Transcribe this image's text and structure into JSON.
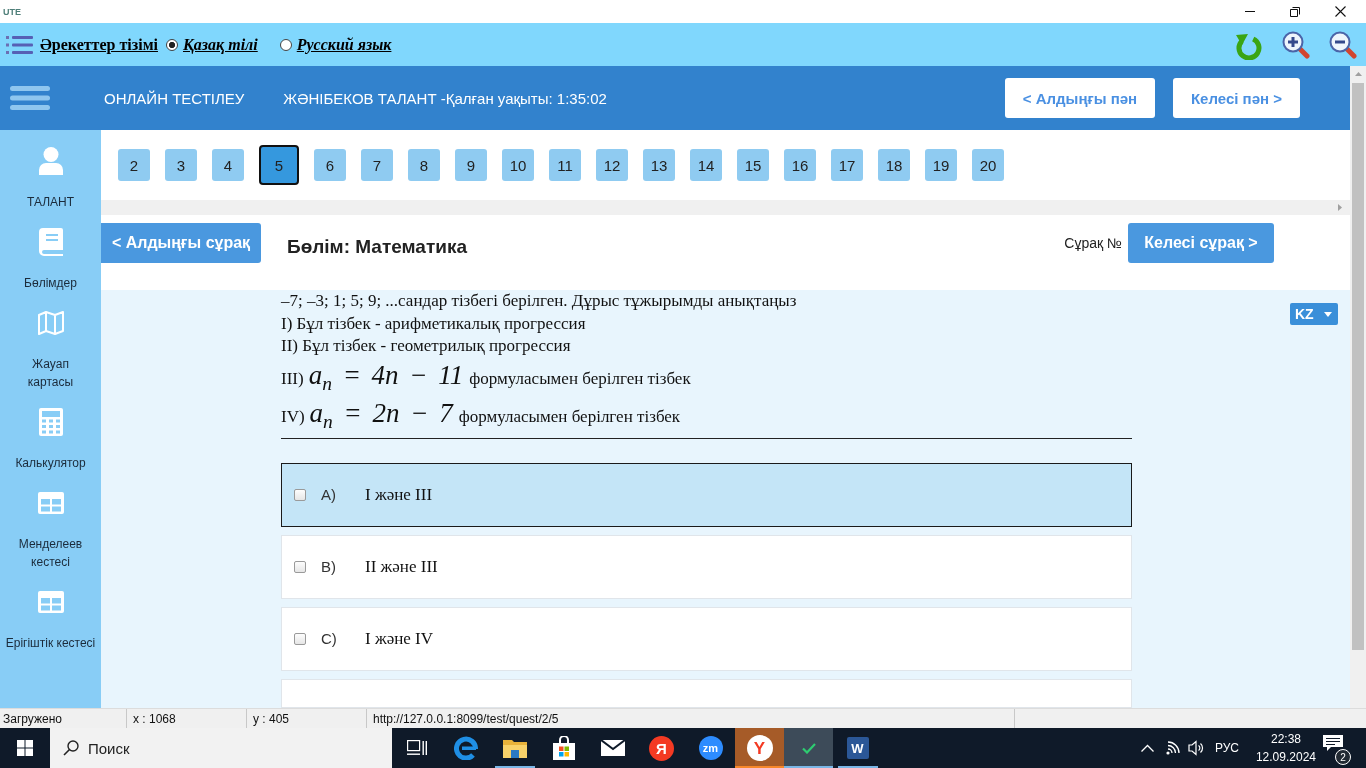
{
  "window": {
    "app_name": "UTE"
  },
  "toolbar": {
    "menu_label": "Әрекеттер тізімі",
    "languages": [
      {
        "label": "Қазақ тілі",
        "selected": true
      },
      {
        "label": "Русский язык",
        "selected": false
      }
    ]
  },
  "header": {
    "title": "ОНЛАЙН ТЕСТІЛЕУ",
    "student": "ЖӘНІБЕКОВ ТАЛАНТ -Қалған уақыты: 1:35:02",
    "prev_button": "< Алдыңғы пән",
    "next_button": "Келесі пән >"
  },
  "sidebar": {
    "items": [
      {
        "kind": "user",
        "label": "ТАЛАНТ"
      },
      {
        "kind": "book",
        "label": "Бөлімдер"
      },
      {
        "kind": "map",
        "label": "Жауап\nкартасы"
      },
      {
        "kind": "calculator",
        "label": "Калькулятор"
      },
      {
        "kind": "table",
        "label": "Менделеев\nкестесі"
      },
      {
        "kind": "table",
        "label": "Ерігіштік кестесі"
      }
    ]
  },
  "question_numbers": [
    {
      "label": "2",
      "selected": false
    },
    {
      "label": "3",
      "selected": false
    },
    {
      "label": "4",
      "selected": false
    },
    {
      "label": "5",
      "selected": true
    },
    {
      "label": "6",
      "selected": false
    },
    {
      "label": "7",
      "selected": false
    },
    {
      "label": "8",
      "selected": false
    },
    {
      "label": "9",
      "selected": false
    },
    {
      "label": "10",
      "selected": false
    },
    {
      "label": "11",
      "selected": false
    },
    {
      "label": "12",
      "selected": false
    },
    {
      "label": "13",
      "selected": false
    },
    {
      "label": "14",
      "selected": false
    },
    {
      "label": "15",
      "selected": false
    },
    {
      "label": "16",
      "selected": false
    },
    {
      "label": "17",
      "selected": false
    },
    {
      "label": "18",
      "selected": false
    },
    {
      "label": "19",
      "selected": false
    },
    {
      "label": "20",
      "selected": false
    }
  ],
  "section": {
    "prev_button": "< Алдыңғы сұрақ",
    "title": "Бөлім: Математика",
    "question_label": "Сұрақ №",
    "next_button": "Келесі сұрақ >"
  },
  "question": {
    "intro": "–7; –3; 1; 5; 9; ...сандар тізбегі берілген. Дұрыс тұжырымды анықтаңыз",
    "statements": [
      {
        "kind": "text",
        "text": "I) Бұл тізбек - арифметикалық прогрессия"
      },
      {
        "kind": "text",
        "text": "II) Бұл тізбек - геометрилық прогрессия"
      },
      {
        "kind": "formula",
        "prefix": "III)",
        "formula": "a$_{n}$ = 4n − 11",
        "text": "формуласымен берілген тізбек"
      },
      {
        "kind": "formula",
        "prefix": "IV)",
        "formula": "a$_{n}$ = 2n − 7",
        "text": "формуласымен берілген тізбек"
      }
    ]
  },
  "language_select": {
    "value": "KZ"
  },
  "options": [
    {
      "letter": "A)",
      "text": "I және III",
      "selected": true,
      "checked": false
    },
    {
      "letter": "B)",
      "text": "II және III",
      "selected": false,
      "checked": false
    },
    {
      "letter": "C)",
      "text": "I және IV",
      "selected": false,
      "checked": false
    },
    {
      "selected": false
    }
  ],
  "status_bar": {
    "state": "Загружено",
    "x": "x : 1068",
    "y": "y : 405",
    "url": "http://127.0.0.1:8099/test/quest/2/5"
  },
  "taskbar": {
    "search_placeholder": "Поиск",
    "apps": [
      {
        "kind": "task-view",
        "running": false,
        "focused": false,
        "flashing": false
      },
      {
        "kind": "browser",
        "running": false,
        "focused": false,
        "flashing": false
      },
      {
        "kind": "folder",
        "running": true,
        "focused": false,
        "flashing": false
      },
      {
        "kind": "store",
        "running": false,
        "focused": false,
        "flashing": false
      },
      {
        "kind": "mail",
        "running": false,
        "focused": false,
        "flashing": false
      },
      {
        "kind": "search-app",
        "glyph": "Я",
        "running": false,
        "focused": false,
        "flashing": false
      },
      {
        "kind": "video-app",
        "glyph": "zm",
        "running": false,
        "focused": false,
        "flashing": false
      },
      {
        "kind": "browser-disc",
        "glyph": "Y",
        "running": true,
        "focused": false,
        "flashing": true
      },
      {
        "kind": "check-app",
        "running": true,
        "focused": true,
        "flashing": false
      },
      {
        "kind": "document",
        "glyph": "W",
        "running": true,
        "focused": false,
        "flashing": false
      }
    ],
    "tray": {
      "language": "РУС",
      "time": "22:38",
      "date": "12.09.2024",
      "notifications": "2"
    }
  }
}
